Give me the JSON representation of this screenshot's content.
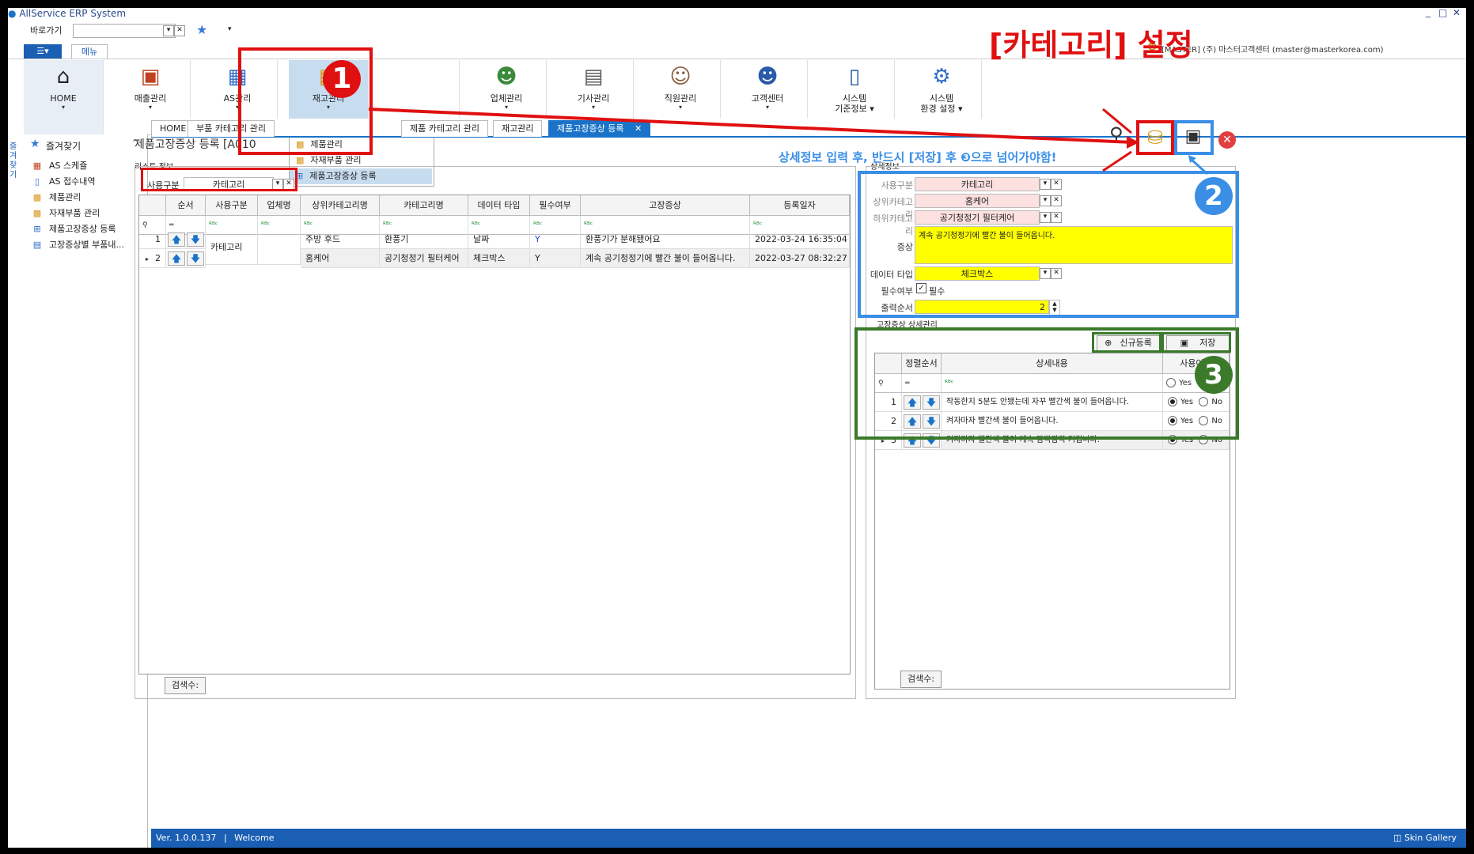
{
  "app": {
    "title": "AllService ERP System",
    "goto_label": "바로가기",
    "menu_tab": "메뉴",
    "user_info": "[MASTER] (주) 마스터고객센터 (master@masterkorea.com)"
  },
  "annotations": {
    "heading": "[카테고리] 설정",
    "instruction": "상세정보 입력 후, 반드시 [저장] 후 ❸으로 넘어가야함!",
    "step1": "1",
    "step2": "2",
    "step3": "3"
  },
  "ribbon": [
    {
      "label": "HOME",
      "icon": "home-icon",
      "glyph": "🏠"
    },
    {
      "label": "매출관리",
      "icon": "sales-icon",
      "glyph": "📊"
    },
    {
      "label": "AS관리",
      "icon": "as-icon",
      "glyph": "📅"
    },
    {
      "label": "재고관리",
      "icon": "inventory-icon",
      "glyph": "📦"
    },
    {
      "label": "",
      "icon": "box-icon",
      "glyph": "📦"
    },
    {
      "label": "업체관리",
      "icon": "company-icon",
      "glyph": "👥"
    },
    {
      "label": "기사관리",
      "icon": "technician-icon",
      "glyph": "🪪"
    },
    {
      "label": "직원관리",
      "icon": "staff-icon",
      "glyph": "👤"
    },
    {
      "label": "고객센터",
      "icon": "customer-center-icon",
      "glyph": "👤"
    },
    {
      "label": "시스템\n기준정보",
      "icon": "system-info-icon",
      "glyph": "📄"
    },
    {
      "label": "시스템\n환경 설정",
      "icon": "system-settings-icon",
      "glyph": "⚙"
    }
  ],
  "inventory_menu": [
    "제품관리",
    "자재부품 관리",
    "제품고장증상 등록"
  ],
  "sidebar": {
    "title": "즐겨찾기",
    "vertical_label": "즐겨찾기",
    "items": [
      "AS 스케쥴",
      "AS 접수내역",
      "제품관리",
      "자재부품 관리",
      "제품고장증상 등록",
      "고장증상별 부품내..."
    ]
  },
  "tabs": [
    "HOME",
    "부품 카테고리 관리",
    "제품 카테고리 관리",
    "재고관리",
    "제품고장증상 등록"
  ],
  "page": {
    "title": "제품고장증상 등록 [A010",
    "list_section": "리스트 정보",
    "filter_label": "사용구분",
    "filter_value": "카테고리",
    "search_count_label": "검색수:"
  },
  "list_grid": {
    "headers": [
      "순서",
      "사용구분",
      "업체명",
      "상위카테고리명",
      "카테고리명",
      "데이터 타입",
      "필수여부",
      "고장증상",
      "등록일자"
    ],
    "rows": [
      {
        "no": "1",
        "usage": "카테고리",
        "company": "",
        "parent": "주방 후드",
        "category": "환풍기",
        "dtype": "날짜",
        "required": "Y",
        "symptom": "환풍기가 분해됐어요",
        "date": "2022-03-24 16:35:04"
      },
      {
        "no": "2",
        "usage": "",
        "company": "",
        "parent": "홈케어",
        "category": "공기청정기 필터케어",
        "dtype": "체크박스",
        "required": "Y",
        "symptom": "계속 공기청정기에 빨간 불이 들어옵니다.",
        "date": "2022-03-27 08:32:27"
      }
    ]
  },
  "detail": {
    "section": "상세정보",
    "usage_label": "사용구분",
    "usage_value": "카테고리",
    "parent_label": "상위카테고리",
    "parent_value": "홈케어",
    "child_label": "하위카테고리",
    "child_value": "공기청정기 필터케어",
    "symptom_label": "증상",
    "symptom_value": "계속 공기청정기에 빨간 불이 들어옵니다.",
    "dtype_label": "데이터 타입",
    "dtype_value": "체크박스",
    "required_label": "필수여부",
    "required_check": "필수",
    "order_label": "출력순서",
    "order_value": "2"
  },
  "symptom_detail": {
    "section": "고장증상 상세관리",
    "new_btn": "신규등록",
    "save_btn": "저장",
    "headers": [
      "정렬순서",
      "상세내용",
      "사용여부"
    ],
    "filter_yes": "Yes",
    "rows": [
      {
        "no": "1",
        "text": "작동한지 5분도 안됐는데 자꾸 빨간색 불이 들어옵니다.",
        "yes": "Yes",
        "no_label": "No"
      },
      {
        "no": "2",
        "text": "켜자마자 빨간색 불이 들어옵니다.",
        "yes": "Yes",
        "no_label": "No"
      },
      {
        "no": "3",
        "text": "켜자마자 빨간색 불이 계속 깜빡깜빡 거립니다.",
        "yes": "Yes",
        "no_label": "No"
      }
    ],
    "search_count_label": "검색수:"
  },
  "status": {
    "version": "Ver. 1.0.0.137",
    "welcome": "Welcome",
    "skin": "Skin Gallery"
  }
}
